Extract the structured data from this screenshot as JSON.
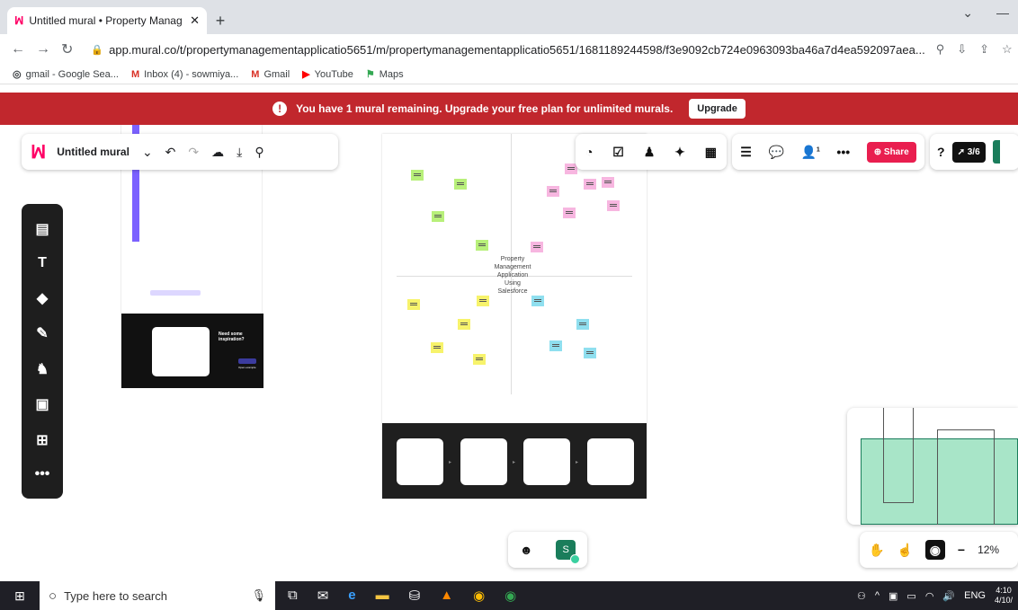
{
  "browser": {
    "tab_title": "Untitled mural • Property Manag",
    "url": "app.mural.co/t/propertymanagementapplicatio5651/m/propertymanagementapplicatio5651/1681189244598/f3e9092cb724e0963093ba46a7d4ea592097aea...",
    "bookmarks": [
      "gmail - Google Sea...",
      "Inbox (4) - sowmiya...",
      "Gmail",
      "YouTube",
      "Maps"
    ]
  },
  "banner": {
    "message": "You have 1 mural remaining. Upgrade your free plan for unlimited murals.",
    "button": "Upgrade",
    "color": "#c1272d"
  },
  "mural": {
    "title": "Untitled mural",
    "board_center": [
      "Property",
      "Management",
      "Application",
      "Using",
      "Salesforce"
    ],
    "share_label": "Share",
    "timer_label": "3/6",
    "collaborator_count": "1",
    "avatar_initial": "S",
    "zoom": "12%"
  },
  "left_card": {
    "heading": "Need some inspiration?",
    "button": "Open example"
  },
  "taskbar": {
    "search_placeholder": "Type here to search",
    "language": "ENG",
    "time": "4:10",
    "date": "4/10/"
  },
  "colors": {
    "green_note": "#b8f07a",
    "pink_note": "#f7b6e0",
    "yellow_note": "#f7f36b",
    "blue_note": "#8fdfef",
    "brand_pink": "#e91e4f"
  }
}
